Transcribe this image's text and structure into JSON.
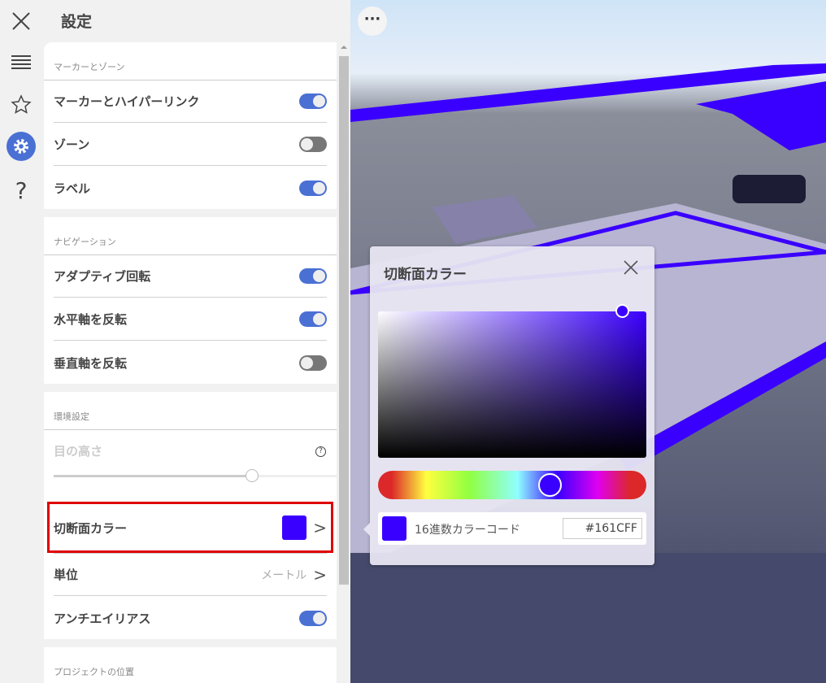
{
  "header": {
    "title": "設定"
  },
  "rail": {
    "items": [
      "close",
      "list",
      "favorites",
      "settings",
      "help"
    ]
  },
  "sections": [
    {
      "title": "マーカーとゾーン",
      "rows": [
        {
          "label": "マーカーとハイパーリンク",
          "on": true
        },
        {
          "label": "ゾーン",
          "on": false
        },
        {
          "label": "ラベル",
          "on": true
        }
      ]
    },
    {
      "title": "ナビゲーション",
      "rows": [
        {
          "label": "アダプティブ回転",
          "on": true
        },
        {
          "label": "水平軸を反転",
          "on": true
        },
        {
          "label": "垂直軸を反転",
          "on": false
        }
      ]
    },
    {
      "title": "環境設定",
      "eye_height": {
        "label": "目の高さ",
        "slider_percent": 70
      },
      "section_color": {
        "label": "切断面カラー",
        "color": "#3a00ff"
      },
      "unit": {
        "label": "単位",
        "value": "メートル"
      },
      "antialias": {
        "label": "アンチエイリアス",
        "on": true
      }
    },
    {
      "title": "プロジェクトの位置"
    }
  ],
  "dialog": {
    "title": "切断面カラー",
    "hex_label": "16進数カラーコード",
    "hex_value": "#161CFF",
    "swatch": "#3a00ff"
  },
  "colors": {
    "accent": "#4a70d4",
    "highlight": "#e00000"
  }
}
